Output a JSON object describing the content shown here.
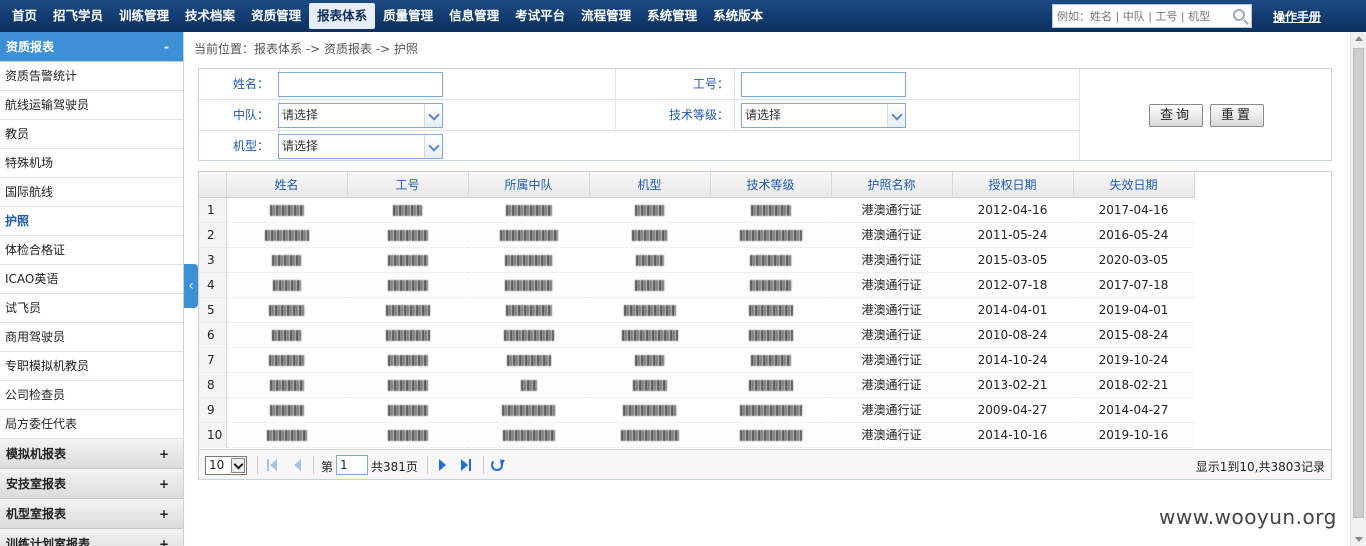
{
  "nav": {
    "items": [
      "首页",
      "招飞学员",
      "训练管理",
      "技术档案",
      "资质管理",
      "报表体系",
      "质量管理",
      "信息管理",
      "考试平台",
      "流程管理",
      "系统管理",
      "系统版本"
    ],
    "active_index": 5,
    "search_placeholder": "例如：姓名 | 中队 | 工号 | 机型",
    "manual_link": "操作手册"
  },
  "sidebar": {
    "open_section": "资质报表",
    "open_toggle": "-",
    "items": [
      "资质告警统计",
      "航线运输驾驶员",
      "教员",
      "特殊机场",
      "国际航线",
      "护照",
      "体检合格证",
      "ICAO英语",
      "试飞员",
      "商用驾驶员",
      "专职模拟机教员",
      "公司检查员",
      "局方委任代表"
    ],
    "active_item_index": 5,
    "collapsed_sections": [
      {
        "label": "模拟机报表",
        "toggle": "+"
      },
      {
        "label": "安技室报表",
        "toggle": "+"
      },
      {
        "label": "机型室报表",
        "toggle": "+"
      },
      {
        "label": "训练计划室报表",
        "toggle": "+"
      }
    ],
    "collapse_glyph": "‹"
  },
  "breadcrumb": "当前位置：报表体系 -> 资质报表 -> 护照",
  "form": {
    "name_label": "姓名：",
    "name_value": "",
    "empno_label": "工号：",
    "empno_value": "",
    "squadron_label": "中队：",
    "squadron_value": "请选择",
    "grade_label": "技术等级：",
    "grade_value": "请选择",
    "model_label": "机型：",
    "model_value": "请选择",
    "query_button": "查询",
    "reset_button": "重置"
  },
  "grid": {
    "columns": [
      "姓名",
      "工号",
      "所属中队",
      "机型",
      "技术等级",
      "护照名称",
      "授权日期",
      "失效日期"
    ],
    "rows": [
      {
        "num": "1",
        "passport": "港澳通行证",
        "auth_date": "2012-04-16",
        "expire_date": "2017-04-16"
      },
      {
        "num": "2",
        "passport": "港澳通行证",
        "auth_date": "2011-05-24",
        "expire_date": "2016-05-24"
      },
      {
        "num": "3",
        "passport": "港澳通行证",
        "auth_date": "2015-03-05",
        "expire_date": "2020-03-05"
      },
      {
        "num": "4",
        "passport": "港澳通行证",
        "auth_date": "2012-07-18",
        "expire_date": "2017-07-18"
      },
      {
        "num": "5",
        "passport": "港澳通行证",
        "auth_date": "2014-04-01",
        "expire_date": "2019-04-01"
      },
      {
        "num": "6",
        "passport": "港澳通行证",
        "auth_date": "2010-08-24",
        "expire_date": "2015-08-24"
      },
      {
        "num": "7",
        "passport": "港澳通行证",
        "auth_date": "2014-10-24",
        "expire_date": "2019-10-24"
      },
      {
        "num": "8",
        "passport": "港澳通行证",
        "auth_date": "2013-02-21",
        "expire_date": "2018-02-21"
      },
      {
        "num": "9",
        "passport": "港澳通行证",
        "auth_date": "2009-04-27",
        "expire_date": "2014-04-27"
      },
      {
        "num": "10",
        "passport": "港澳通行证",
        "auth_date": "2014-10-16",
        "expire_date": "2019-10-16"
      }
    ]
  },
  "pager": {
    "page_size": "10",
    "page_prefix": "第",
    "current_page": "1",
    "total_pages": "共381页",
    "summary": "显示1到10,共3803记录"
  },
  "watermark": "www.wooyun.org",
  "colors": {
    "nav_bg": "#0c2f5f",
    "accent": "#3d8fd6",
    "link_blue": "#1e5bb0"
  }
}
